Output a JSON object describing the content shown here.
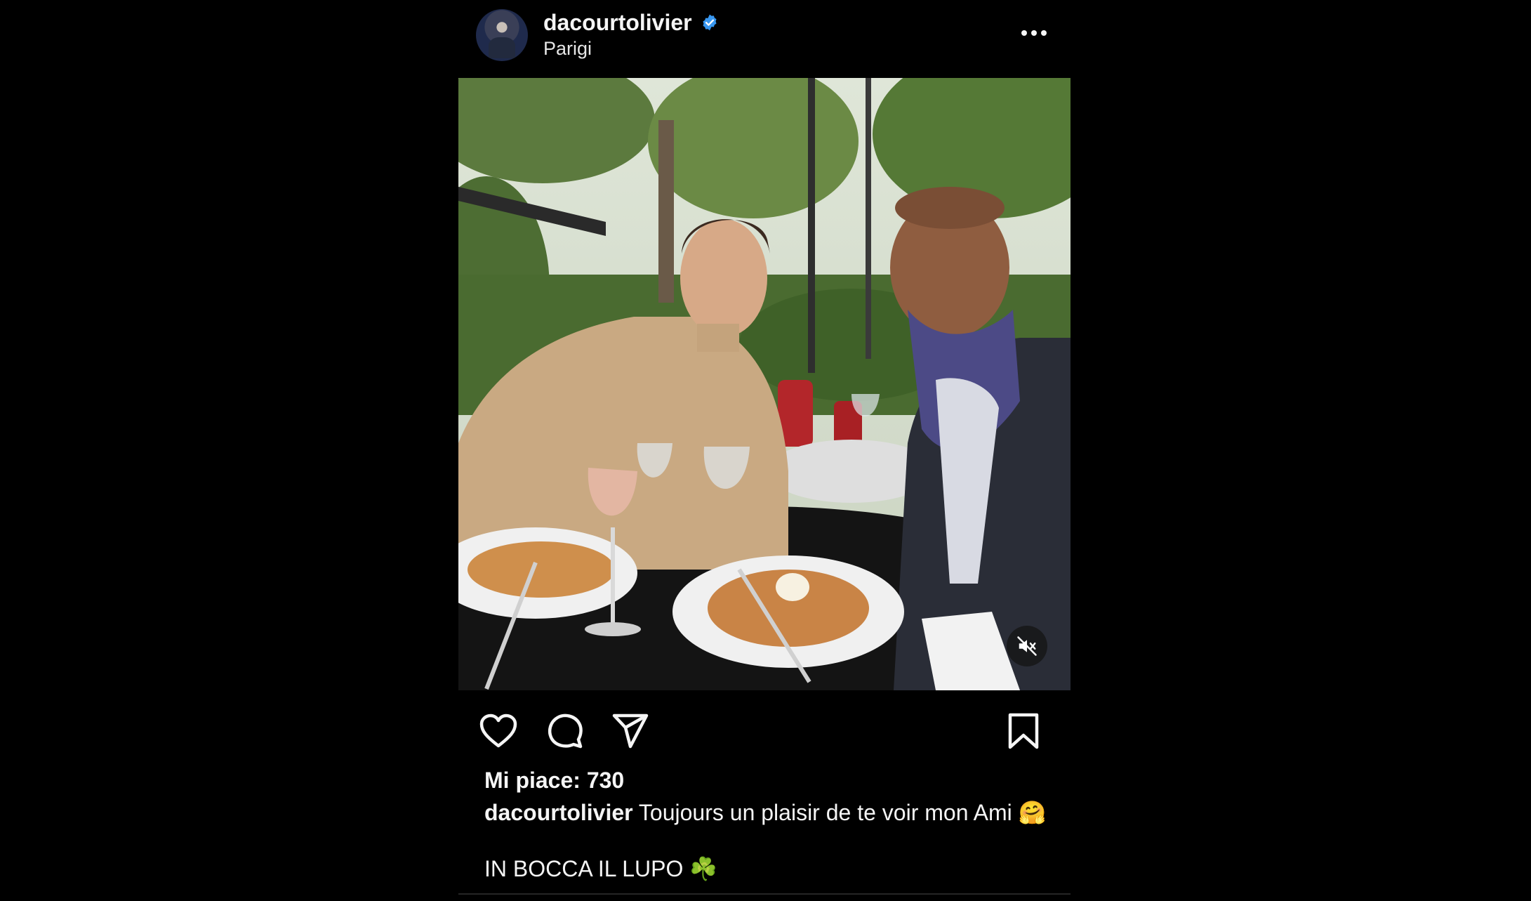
{
  "post": {
    "username": "dacourtolivier",
    "location": "Parigi",
    "verified": true,
    "likes_text": "Mi piace: 730",
    "caption_user": "dacourtolivier",
    "caption_text": "Toujours un plaisir de te voir mon Ami 🤗",
    "caption_line2": "IN BOCCA IL LUPO ☘️"
  },
  "icons": {
    "more": "more-options-icon",
    "like": "heart-icon",
    "comment": "comment-icon",
    "share": "send-icon",
    "save": "bookmark-icon",
    "mute": "speaker-muted-icon",
    "verified": "verified-badge-icon"
  },
  "colors": {
    "background": "#000000",
    "text": "#f5f5f5",
    "verified": "#3897f0"
  }
}
